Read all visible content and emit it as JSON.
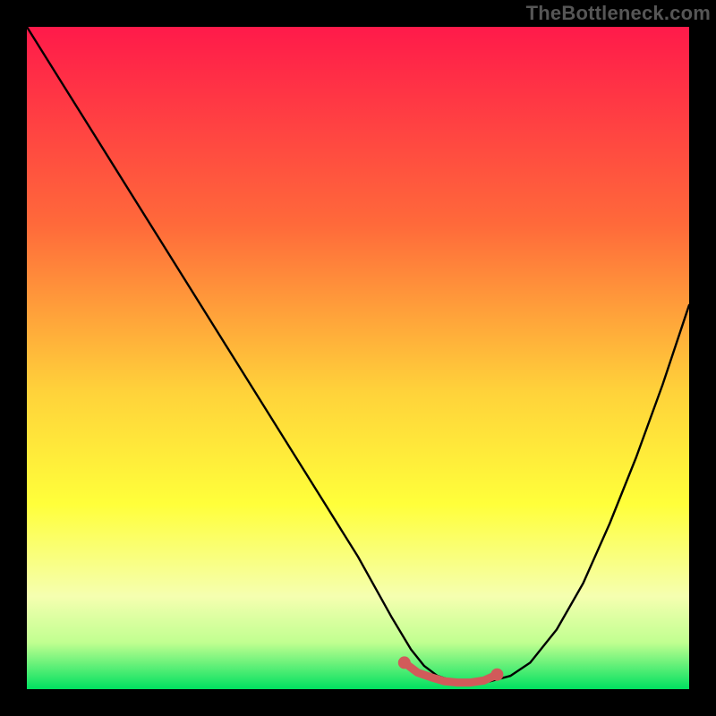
{
  "watermark": "TheBottleneck.com",
  "colors": {
    "frame": "#000000",
    "curve": "#000000",
    "markers": "#d15a5a",
    "gradient_top": "#ff1a4a",
    "gradient_mid1": "#ff6a3a",
    "gradient_mid2": "#ffd23a",
    "gradient_mid3": "#ffff3a",
    "gradient_low1": "#f5ffb0",
    "gradient_low2": "#c0ff90",
    "gradient_bottom": "#00e060"
  },
  "chart_data": {
    "type": "line",
    "title": "",
    "xlabel": "",
    "ylabel": "",
    "xlim": [
      0,
      100
    ],
    "ylim": [
      0,
      100
    ],
    "series": [
      {
        "name": "curve",
        "x": [
          0,
          5,
          10,
          15,
          20,
          25,
          30,
          35,
          40,
          45,
          50,
          55,
          58,
          60,
          62,
          65,
          68,
          70,
          73,
          76,
          80,
          84,
          88,
          92,
          96,
          100
        ],
        "values": [
          100,
          92,
          84,
          76,
          68,
          60,
          52,
          44,
          36,
          28,
          20,
          11,
          6,
          3.5,
          2,
          1,
          1,
          1.2,
          2,
          4,
          9,
          16,
          25,
          35,
          46,
          58
        ]
      }
    ],
    "markers": {
      "name": "highlight-segment",
      "x": [
        57,
        59,
        61,
        63,
        65,
        67,
        69,
        71
      ],
      "values": [
        4,
        2.5,
        1.8,
        1.2,
        1.0,
        1.0,
        1.3,
        2.2
      ]
    }
  }
}
